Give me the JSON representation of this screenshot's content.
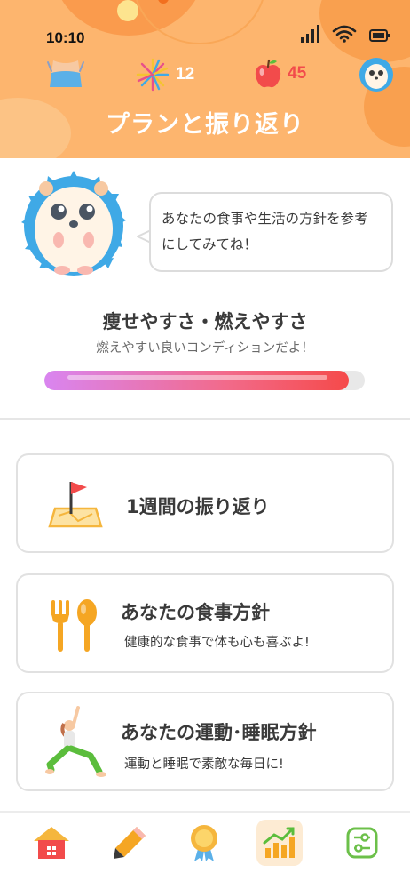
{
  "status_bar": {
    "time": "10:10"
  },
  "header": {
    "title": "プランと振り返り",
    "stats": {
      "fireworks_count": "12",
      "apples_count": "45"
    }
  },
  "mascot_message": "あなたの食事や生活の方針を参考にしてみてね！",
  "condition": {
    "title": "痩せやすさ・燃えやすさ",
    "subtitle": "燃えやすい良いコンディションだよ！",
    "progress_fraction": 0.95
  },
  "cards": [
    {
      "title": "1週間の振り返り",
      "subtitle": ""
    },
    {
      "title": "あなたの食事方針",
      "subtitle": "健康的な食事で体も心も喜ぶよ!"
    },
    {
      "title": "あなたの運動･睡眠方針",
      "subtitle": "運動と睡眠で素敵な毎日に!"
    }
  ],
  "nav": {
    "items": [
      "home-icon",
      "pencil-icon",
      "medal-icon",
      "chart-icon",
      "settings-icon"
    ],
    "active_index": 3
  },
  "colors": {
    "header_bg": "#fdb56e",
    "accent_red": "#f24b4b",
    "mascot_blue": "#3fa9e6",
    "progress_start": "#d985f0",
    "progress_end": "#f54a4a"
  }
}
